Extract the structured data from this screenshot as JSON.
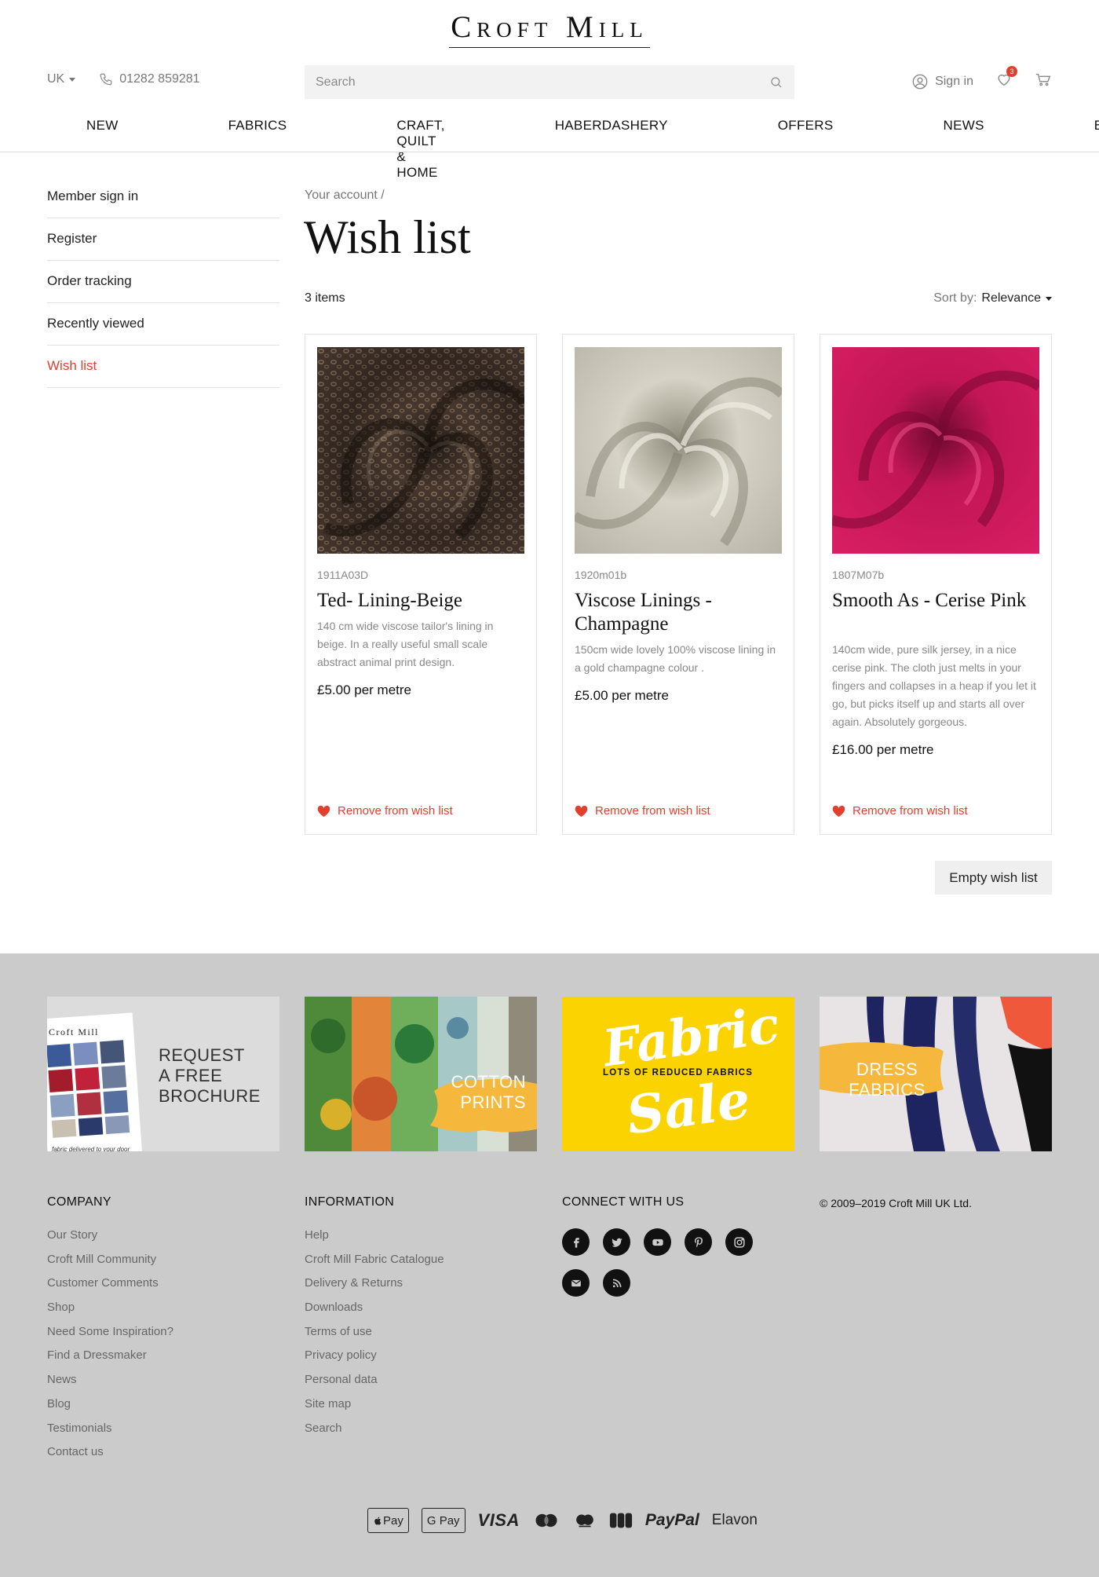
{
  "brand": {
    "logo_text": "Croft Mill"
  },
  "header": {
    "country": "UK",
    "phone": "01282 859281",
    "search_placeholder": "Search",
    "sign_in": "Sign in",
    "wishlist_count": "3"
  },
  "nav": [
    "NEW",
    "FABRICS",
    "CRAFT, QUILT & HOME",
    "HABERDASHERY",
    "OFFERS",
    "NEWS",
    "BLOG"
  ],
  "sidebar": {
    "items": [
      {
        "label": "Member sign in"
      },
      {
        "label": "Register"
      },
      {
        "label": "Order tracking"
      },
      {
        "label": "Recently viewed"
      },
      {
        "label": "Wish list"
      }
    ]
  },
  "main": {
    "breadcrumb": "Your account  /",
    "title": "Wish list",
    "items_count": "3 items",
    "sort_label": "Sort by:",
    "sort_value": "Relevance",
    "products": [
      {
        "sku": "1911A03D",
        "name": "Ted- Lining-Beige",
        "description": "140 cm wide viscose tailor's lining in beige. In a really useful small scale abstract animal print design.",
        "price": "£5.00 per metre",
        "remove_label": "Remove from wish list"
      },
      {
        "sku": "1920m01b",
        "name": "Viscose Linings - Champagne",
        "description": "150cm wide lovely 100% viscose lining in a gold champagne colour .",
        "price": "£5.00 per metre",
        "remove_label": "Remove from wish list"
      },
      {
        "sku": "1807M07b",
        "name": "Smooth As - Cerise Pink",
        "description": "140cm wide, pure silk jersey, in a nice cerise pink. The cloth just melts in your fingers and collapses in a heap if you let it go, but picks itself up and starts all over again. Absolutely gorgeous.",
        "price": "£16.00 per metre",
        "remove_label": "Remove from wish list"
      }
    ],
    "empty_button": "Empty wish list"
  },
  "promos": {
    "brochure": {
      "logo": "Croft Mill",
      "label": "REQUEST\nA FREE\nBROCHURE",
      "tagline": "fabric delivered to your door"
    },
    "cotton": {
      "label": "COTTON\nPRINTS"
    },
    "sale": {
      "word1": "Fabric",
      "strap": "LOTS OF REDUCED FABRICS",
      "word2": "Sale"
    },
    "dress": {
      "label": "DRESS\nFABRICS"
    }
  },
  "footer": {
    "company": {
      "heading": "COMPANY",
      "links": [
        "Our Story",
        "Croft Mill Community",
        "Customer Comments",
        "Shop",
        "Need Some Inspiration?",
        "Find a Dressmaker",
        "News",
        "Blog",
        "Testimonials",
        "Contact us"
      ]
    },
    "information": {
      "heading": "INFORMATION",
      "links": [
        "Help",
        "Croft Mill Fabric Catalogue",
        "Delivery & Returns",
        "Downloads",
        "Terms of use",
        "Privacy policy",
        "Personal data",
        "Site map",
        "Search"
      ]
    },
    "connect": {
      "heading": "CONNECT WITH US",
      "icons": [
        "facebook-icon",
        "twitter-icon",
        "youtube-icon",
        "pinterest-icon",
        "instagram-icon",
        "email-icon",
        "rss-icon"
      ]
    },
    "copyright": "© 2009–2019  Croft Mill UK Ltd.",
    "payments": {
      "apple": "Pay",
      "google": "G Pay",
      "visa": "VISA",
      "paypal": "PayPal",
      "elavon": "Elavon"
    }
  },
  "colors": {
    "accent": "#e0402e",
    "footer_bg": "#cbcbcb",
    "sale_yellow": "#fbd300",
    "banner_orange": "#f6b83c"
  }
}
